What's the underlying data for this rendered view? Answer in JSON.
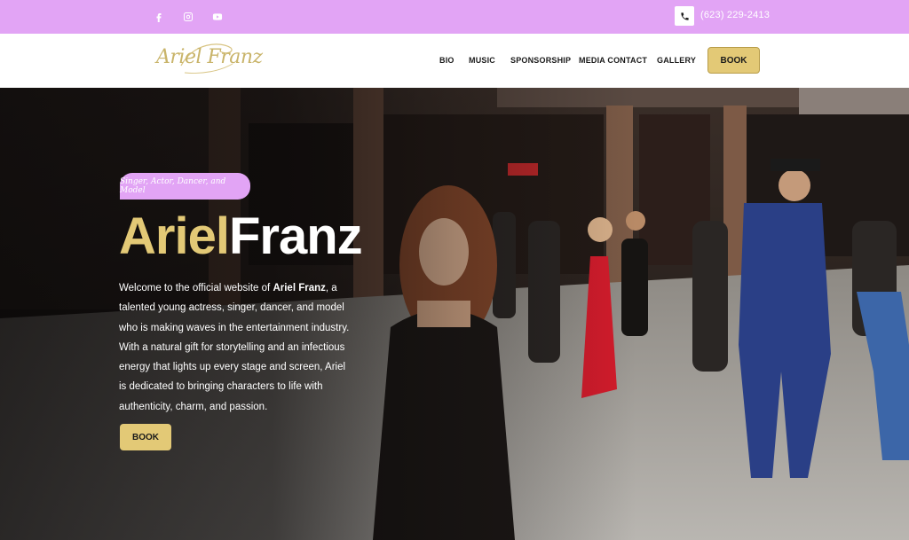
{
  "colors": {
    "topbar": "#e2a4f5",
    "accent_gold": "#e3c976",
    "pill": "#e2a4f5",
    "text_dark": "#1a1a1a"
  },
  "topbar": {
    "social": [
      {
        "icon": "facebook-icon"
      },
      {
        "icon": "instagram-icon"
      },
      {
        "icon": "youtube-icon"
      }
    ],
    "phone_icon": "phone-icon",
    "phone": "(623) 229-2413"
  },
  "header": {
    "logo_text": "Ariel Franz",
    "nav": [
      {
        "label": "BIO"
      },
      {
        "label": "MUSIC"
      },
      {
        "label": "SPONSORSHIP"
      },
      {
        "label": "MEDIA CONTACT"
      },
      {
        "label": "GALLERY"
      }
    ],
    "book_label": "BOOK"
  },
  "hero": {
    "tagline": "Singer, Actor, Dancer, and Model",
    "first_name": "Ariel",
    "last_name": "Franz",
    "intro_before": "Welcome to the official website of ",
    "intro_name": "Ariel Franz",
    "intro_after": ", a talented young actress, singer, dancer, and model who is making waves in the entertainment industry. With a natural gift for storytelling and an infectious energy that lights up every stage and screen, Ariel is dedicated to bringing characters to life with authenticity, charm, and passion.",
    "book_label": "BOOK"
  }
}
